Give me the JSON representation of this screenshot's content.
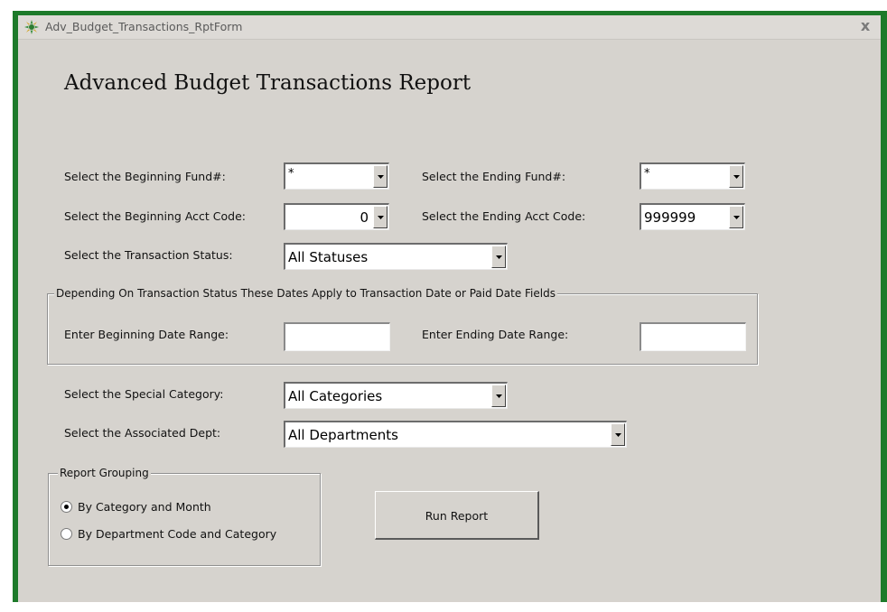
{
  "window": {
    "title": "Adv_Budget_Transactions_RptForm",
    "close_label": "x"
  },
  "form": {
    "heading": "Advanced Budget Transactions Report",
    "beginning_fund": {
      "label": "Select the Beginning Fund#:",
      "value": "*"
    },
    "ending_fund": {
      "label": "Select the Ending Fund#:",
      "value": "*"
    },
    "beginning_acct": {
      "label": "Select the Beginning Acct Code:",
      "value": "0"
    },
    "ending_acct": {
      "label": "Select the Ending Acct Code:",
      "value": "999999"
    },
    "transaction_status": {
      "label": "Select the Transaction Status:",
      "value": "All Statuses"
    },
    "date_group": {
      "caption": "Depending On Transaction Status These Dates Apply to Transaction Date or Paid Date Fields",
      "begin_label": "Enter Beginning Date Range:",
      "begin_value": "",
      "end_label": "Enter Ending Date Range:",
      "end_value": ""
    },
    "special_category": {
      "label": "Select the Special Category:",
      "value": "All Categories"
    },
    "associated_dept": {
      "label": "Select the Associated Dept:",
      "value": "All Departments"
    },
    "report_grouping": {
      "caption": "Report Grouping",
      "options": [
        {
          "label": "By Category and Month",
          "selected": true
        },
        {
          "label": "By Department Code and Category",
          "selected": false
        }
      ]
    },
    "run_button": "Run Report"
  },
  "colors": {
    "frame_green": "#1d7a2a",
    "form_background": "#d6d3ce"
  }
}
